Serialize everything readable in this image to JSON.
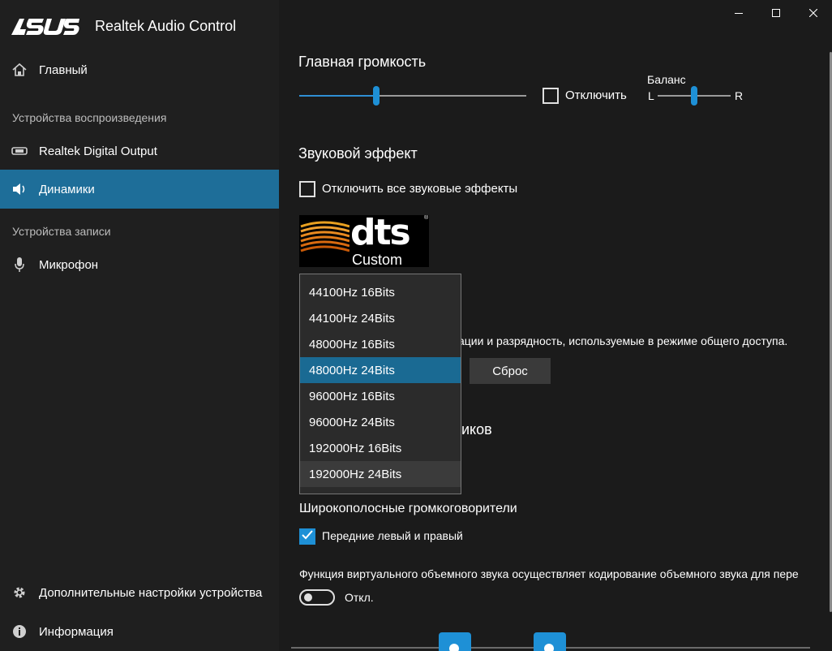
{
  "app": {
    "brand": "/ISUS",
    "title": "Realtek Audio Control"
  },
  "sidebar": {
    "home_label": "Главный",
    "playback_section": "Устройства воспроизведения",
    "playback_items": [
      {
        "label": "Realtek Digital Output",
        "icon": "digital-output-icon"
      },
      {
        "label": "Динамики",
        "icon": "speaker-icon",
        "active": true
      }
    ],
    "recording_section": "Устройства записи",
    "recording_items": [
      {
        "label": "Микрофон",
        "icon": "microphone-icon"
      }
    ],
    "advanced_label": "Дополнительные настройки устройства",
    "info_label": "Информация"
  },
  "main": {
    "volume_title": "Главная громкость",
    "volume_level": 0.34,
    "mute_label": "Отключить",
    "balance_label": "Баланс",
    "balance_left": "L",
    "balance_right": "R",
    "balance_level": 0.5,
    "effect_title": "Звуковой эффект",
    "disable_effects_label": "Отключить все звуковые эффекты",
    "dts_word": "dts",
    "dts_sub": "Custom",
    "dts_reg": "®",
    "format_desc_partial": "ации и разрядность, используемые в режиме общего доступа.",
    "reset_label": "Сброс",
    "speaker_config_partial": "иков",
    "wideband_title": "Широкополосные громкоговорители",
    "front_lr_label": "Передние левый и правый",
    "front_lr_checked": true,
    "virtual_surround_desc": "Функция виртуального объемного звука осуществляет кодирование объемного звука для пере",
    "toggle_label": "Откл."
  },
  "dropdown": {
    "options": [
      "44100Hz 16Bits",
      "44100Hz 24Bits",
      "48000Hz 16Bits",
      "48000Hz 24Bits",
      "96000Hz 16Bits",
      "96000Hz 24Bits",
      "192000Hz 16Bits",
      "192000Hz 24Bits"
    ],
    "selected": "48000Hz 24Bits",
    "hovered": "192000Hz 24Bits"
  },
  "colors": {
    "accent": "#1e90d6",
    "active_nav": "#1e6e99",
    "selected_item": "#1a6a93"
  }
}
